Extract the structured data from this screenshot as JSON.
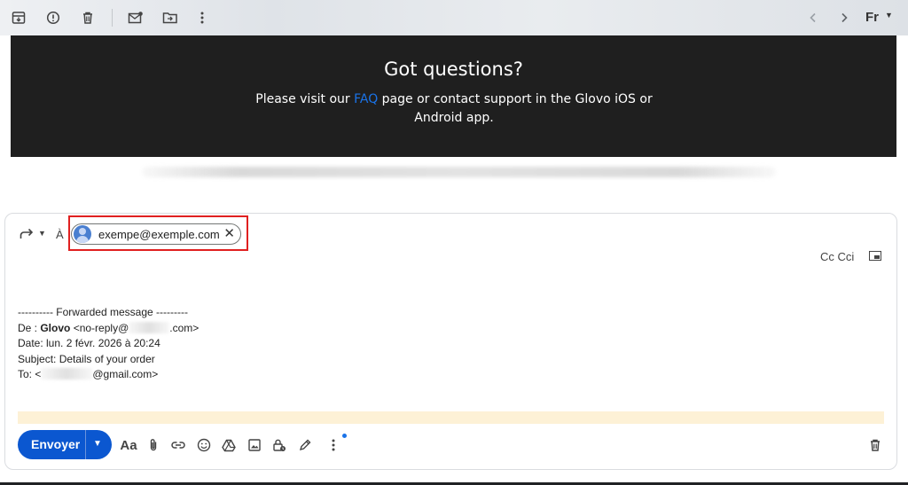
{
  "toolbar": {
    "icons": [
      "archive-icon",
      "report-spam-icon",
      "delete-icon",
      "mark-unread-icon",
      "move-to-icon",
      "more-icon"
    ],
    "nav": [
      "prev-icon",
      "next-icon"
    ],
    "font_label": "Fr"
  },
  "banner": {
    "title": "Got questions?",
    "text_before": "Please visit our ",
    "faq_link": "FAQ",
    "text_after": " page or contact support in the Glovo iOS or Android app.",
    "background": "#1f1f1f",
    "link_color": "#1a73e8"
  },
  "compose": {
    "to_label": "À",
    "recipient": "exempe@exemple.com",
    "cc_label": "Cc Cci",
    "forwarded": {
      "header": "---------- Forwarded message ---------",
      "from_label": "De : ",
      "from_name": "Glovo",
      "from_email_start": "<no-reply@",
      "from_email_end": ".com>",
      "date": "Date: lun. 2 févr. 2026 à 20:24",
      "subject": "Subject: Details of your order",
      "to_start": "To: <",
      "to_end": "@gmail.com>"
    },
    "send_label": "Envoyer",
    "format_label": "Aa",
    "accent": "#0b57d0",
    "highlight": "#e02020"
  }
}
